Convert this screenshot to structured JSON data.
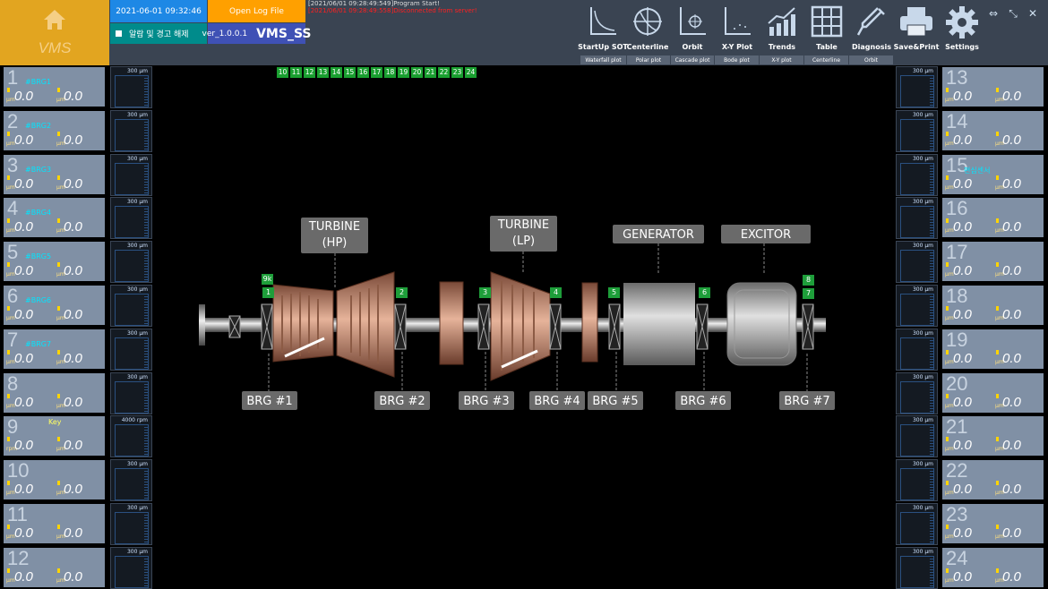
{
  "header": {
    "home_label": "VMS",
    "datetime": "2021-06-01 09:32:46",
    "open_log": "Open Log File",
    "alarm_reset": "알람 및 경고 해제",
    "version": "ver_1.0.0.1",
    "app_name": "VMS_SS",
    "log_line1": "[2021/06/01 09:28:49:549]Program Start!",
    "log_line2": "[2021/06/01 09:28:49:558]Disconnected from server!"
  },
  "tools": [
    {
      "label": "StartUp SOT",
      "icon": "startup-sot-icon",
      "sub": "Waterfall plot"
    },
    {
      "label": "Centerline",
      "icon": "centerline-icon",
      "sub": "Polar plot"
    },
    {
      "label": "Orbit",
      "icon": "orbit-icon",
      "sub": "Cascade plot"
    },
    {
      "label": "X-Y Plot",
      "icon": "xy-plot-icon",
      "sub": "Bode plot"
    },
    {
      "label": "Trends",
      "icon": "trends-icon",
      "sub": "X-Y plot"
    },
    {
      "label": "Table",
      "icon": "table-icon",
      "sub": "Centerline"
    },
    {
      "label": "Diagnosis",
      "icon": "diagnosis-icon",
      "sub": "Orbit"
    },
    {
      "label": "Save&Print",
      "icon": "printer-icon"
    },
    {
      "label": "Settings",
      "icon": "gear-icon"
    }
  ],
  "channel_tabs": [
    "10",
    "11",
    "12",
    "13",
    "14",
    "15",
    "16",
    "17",
    "18",
    "19",
    "20",
    "21",
    "22",
    "23",
    "24"
  ],
  "left_cards": [
    {
      "num": "1",
      "name": "#BRG1",
      "v1": "0.0",
      "v2": "0.0",
      "u1": "μm",
      "u2": "μm",
      "scale": "300 μm"
    },
    {
      "num": "2",
      "name": "#BRG2",
      "v1": "0.0",
      "v2": "0.0",
      "u1": "μm",
      "u2": "μm",
      "scale": "300 μm"
    },
    {
      "num": "3",
      "name": "#BRG3",
      "v1": "0.0",
      "v2": "0.0",
      "u1": "μm",
      "u2": "μm",
      "scale": "300 μm"
    },
    {
      "num": "4",
      "name": "#BRG4",
      "v1": "0.0",
      "v2": "0.0",
      "u1": "μm",
      "u2": "μm",
      "scale": "300 μm"
    },
    {
      "num": "5",
      "name": "#BRG5",
      "v1": "0.0",
      "v2": "0.0",
      "u1": "μm",
      "u2": "μm",
      "scale": "300 μm"
    },
    {
      "num": "6",
      "name": "#BRG6",
      "v1": "0.0",
      "v2": "0.0",
      "u1": "μm",
      "u2": "μm",
      "scale": "300 μm"
    },
    {
      "num": "7",
      "name": "#BRG7",
      "v1": "0.0",
      "v2": "0.0",
      "u1": "μm",
      "u2": "μm",
      "scale": "300 μm"
    },
    {
      "num": "8",
      "name": "",
      "v1": "0.0",
      "v2": "0.0",
      "u1": "μm",
      "u2": "μm",
      "scale": "300 μm"
    },
    {
      "num": "9",
      "name": "Key",
      "v1": "0.0",
      "v2": "0.0",
      "u1": "rpm",
      "u2": "μm",
      "scale": "4000 rpm"
    },
    {
      "num": "10",
      "name": "",
      "v1": "0.0",
      "v2": "0.0",
      "u1": "μm",
      "u2": "μm",
      "scale": "300 μm"
    },
    {
      "num": "11",
      "name": "",
      "v1": "0.0",
      "v2": "0.0",
      "u1": "μm",
      "u2": "μm",
      "scale": "300 μm"
    },
    {
      "num": "12",
      "name": "",
      "v1": "0.0",
      "v2": "0.0",
      "u1": "μm",
      "u2": "μm",
      "scale": "300 μm"
    }
  ],
  "right_cards": [
    {
      "num": "13",
      "name": "",
      "v1": "0.0",
      "v2": "0.0",
      "u1": "μm",
      "u2": "μm",
      "scale": "300 μm"
    },
    {
      "num": "14",
      "name": "",
      "v1": "0.0",
      "v2": "0.0",
      "u1": "μm",
      "u2": "μm",
      "scale": "300 μm"
    },
    {
      "num": "15",
      "name": "편심센서",
      "v1": "0.0",
      "v2": "0.0",
      "u1": "μm",
      "u2": "μm",
      "scale": "300 μm"
    },
    {
      "num": "16",
      "name": "",
      "v1": "0.0",
      "v2": "0.0",
      "u1": "μm",
      "u2": "μm",
      "scale": "300 μm"
    },
    {
      "num": "17",
      "name": "",
      "v1": "0.0",
      "v2": "0.0",
      "u1": "μm",
      "u2": "μm",
      "scale": "300 μm"
    },
    {
      "num": "18",
      "name": "",
      "v1": "0.0",
      "v2": "0.0",
      "u1": "μm",
      "u2": "μm",
      "scale": "300 μm"
    },
    {
      "num": "19",
      "name": "",
      "v1": "0.0",
      "v2": "0.0",
      "u1": "μm",
      "u2": "μm",
      "scale": "300 μm"
    },
    {
      "num": "20",
      "name": "",
      "v1": "0.0",
      "v2": "0.0",
      "u1": "μm",
      "u2": "μm",
      "scale": "300 μm"
    },
    {
      "num": "21",
      "name": "",
      "v1": "0.0",
      "v2": "0.0",
      "u1": "μm",
      "u2": "μm",
      "scale": "300 μm"
    },
    {
      "num": "22",
      "name": "",
      "v1": "0.0",
      "v2": "0.0",
      "u1": "μm",
      "u2": "μm",
      "scale": "300 μm"
    },
    {
      "num": "23",
      "name": "",
      "v1": "0.0",
      "v2": "0.0",
      "u1": "μm",
      "u2": "μm",
      "scale": "300 μm"
    },
    {
      "num": "24",
      "name": "",
      "v1": "0.0",
      "v2": "0.0",
      "u1": "μm",
      "u2": "μm",
      "scale": "300 μm"
    }
  ],
  "machine": {
    "turbine_hp": [
      "TURBINE",
      "(HP)"
    ],
    "turbine_lp": [
      "TURBINE",
      "(LP)"
    ],
    "generator": "GENERATOR",
    "excitor": "EXCITOR",
    "bearings": [
      "BRG #1",
      "BRG #2",
      "BRG #3",
      "BRG #4",
      "BRG #5",
      "BRG #6",
      "BRG #7"
    ],
    "badges": [
      "9k",
      "1",
      "2",
      "3",
      "4",
      "5",
      "6",
      "8",
      "7"
    ]
  }
}
